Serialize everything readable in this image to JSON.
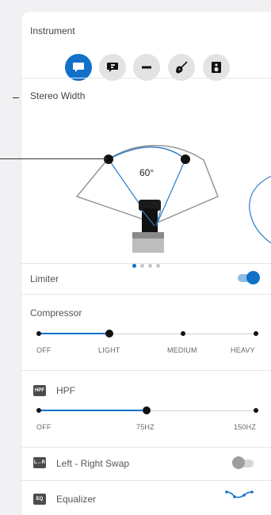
{
  "instrument": {
    "label": "Instrument",
    "buttons": [
      {
        "icon": "speech-bubble-icon",
        "selected": true
      },
      {
        "icon": "speech-bubble-alt-icon",
        "selected": false
      },
      {
        "icon": "minus-icon",
        "selected": false
      },
      {
        "icon": "guitar-icon",
        "selected": false
      },
      {
        "icon": "speaker-icon",
        "selected": false
      }
    ]
  },
  "stereo_width": {
    "label": "Stereo Width",
    "angle_label": "60°",
    "pager_pages": 4,
    "pager_active": 0
  },
  "limiter": {
    "label": "Limiter",
    "on": true
  },
  "compressor": {
    "label": "Compressor",
    "options": [
      "OFF",
      "LIGHT",
      "MEDIUM",
      "HEAVY"
    ],
    "selected": "LIGHT"
  },
  "hpf": {
    "tag": "HPF",
    "label": "HPF",
    "options": [
      "OFF",
      "75HZ",
      "150HZ"
    ],
    "selected": "75HZ"
  },
  "swap": {
    "tag": "L↔R",
    "label": "Left - Right Swap",
    "on": false
  },
  "equalizer": {
    "tag": "EQ",
    "label": "Equalizer"
  },
  "colors": {
    "accent": "#1171c9",
    "track_off": "#d6d6d6",
    "knob_off": "#9e9e9e"
  }
}
